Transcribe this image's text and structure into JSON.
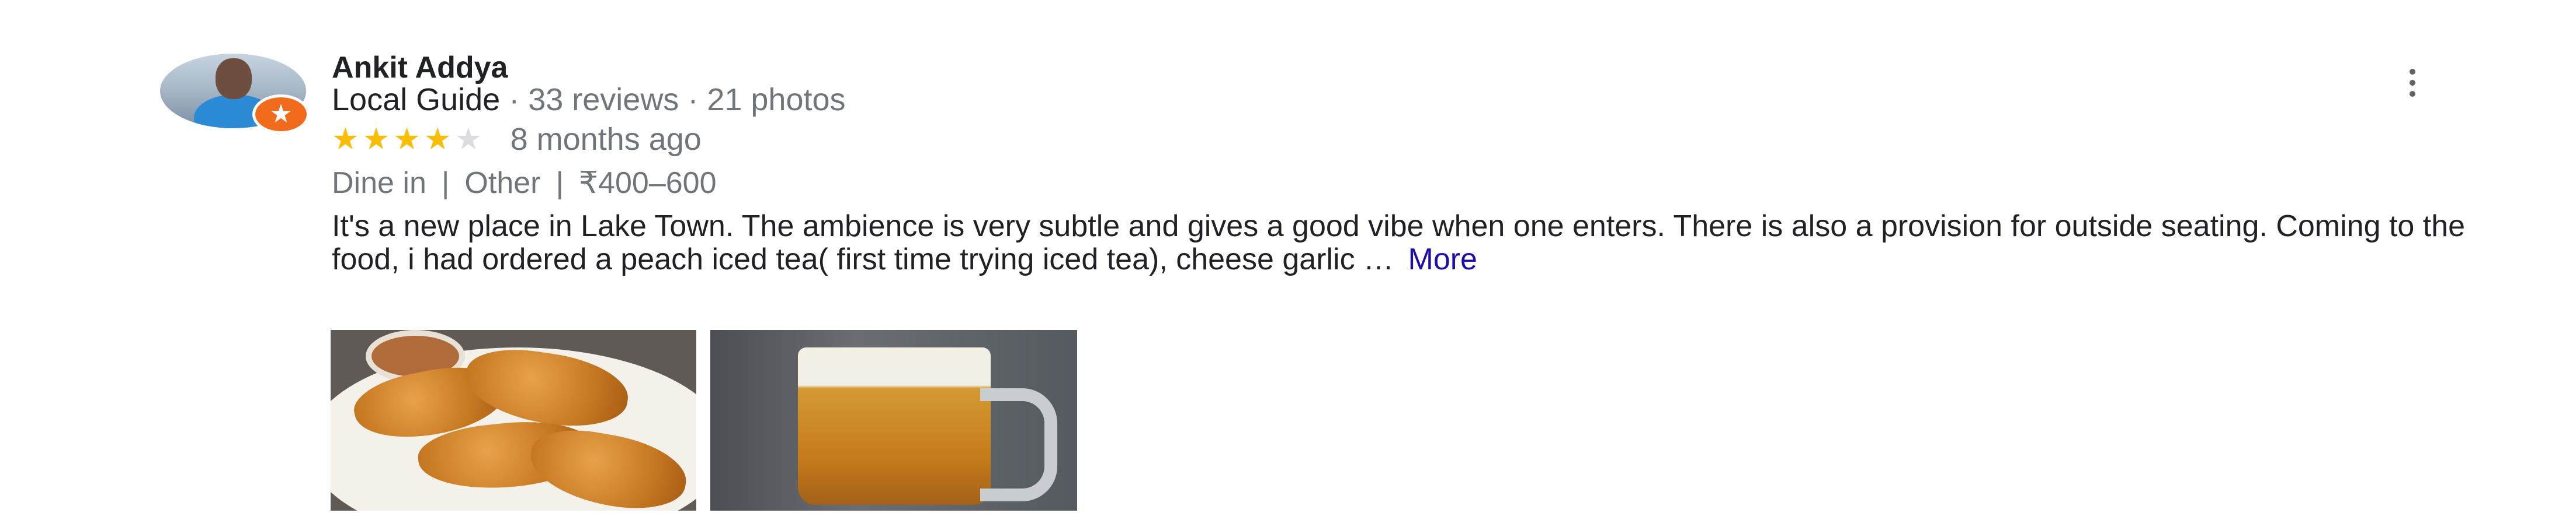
{
  "review": {
    "author": {
      "name": "Ankit Addya",
      "local_guide_label": "Local Guide",
      "separator": " · ",
      "reviews_count": "33 reviews",
      "photos_count": "21 photos",
      "avatar_icon": "user-avatar-photo",
      "badge_icon": "local-guide-star-badge"
    },
    "rating": {
      "stars_filled": 4,
      "stars_total": 5,
      "star_color": "#fbbc04",
      "star_empty_color": "#dadce0",
      "time_ago": "8 months ago"
    },
    "tags": {
      "service": "Dine in",
      "meal_type": "Other",
      "price_range": "₹400–600",
      "separator": "|"
    },
    "text": "It's a new place in Lake Town. The ambience is very subtle and gives a good vibe when one enters. There is also a provision for outside seating. Coming to the food, i had ordered a peach iced tea( first time trying iced tea), cheese garlic …",
    "more_label": "More",
    "more_color": "#1a0dab",
    "photos": [
      {
        "icon": "fried-food-photo"
      },
      {
        "icon": "iced-tea-mug-photo"
      }
    ],
    "menu_icon": "more-vert-icon"
  }
}
